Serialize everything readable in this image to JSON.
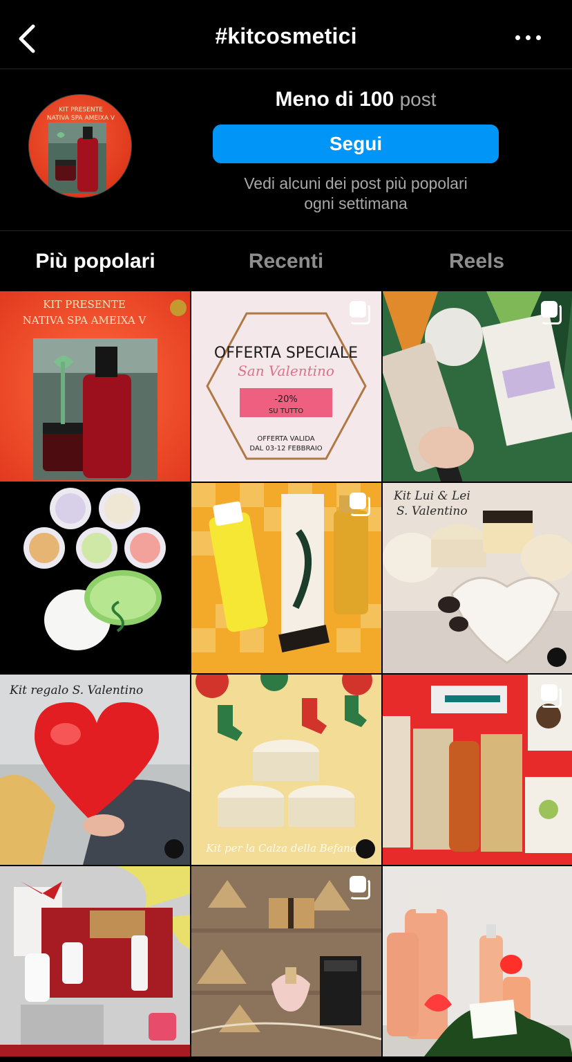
{
  "header": {
    "title": "#kitcosmetici",
    "back_icon": "chevron-left-icon",
    "more_icon": "more-horizontal-icon"
  },
  "hero": {
    "count_number": "Meno di 100",
    "count_unit": "post",
    "follow_label": "Segui",
    "hint_line1": "Vedi alcuni dei post più popolari",
    "hint_line2": "ogni settimana",
    "avatar_text_line1": "KIT PRESENTE",
    "avatar_text_line2": "NATIVA SPA AMEIXA V"
  },
  "tabs": [
    {
      "label": "Più popolari",
      "active": true
    },
    {
      "label": "Recenti",
      "active": false
    },
    {
      "label": "Reels",
      "active": false
    }
  ],
  "tiles": {
    "t1": {
      "line1": "KIT PRESENTE",
      "line2": "NATIVA SPA AMEIXA V"
    },
    "t2": {
      "title": "OFFERTA SPECIALE",
      "script": "San Valentino",
      "discount": "-20%",
      "discount_sub": "SU TUTTO",
      "valid1": "OFFERTA VALIDA",
      "valid2": "DAL 03-12 FEBBRAIO"
    },
    "t6": {
      "line1": "Kit Lui & Lei",
      "line2": "S. Valentino"
    },
    "t7": {
      "line1": "Kit regalo S. Valentino"
    },
    "t8": {
      "line1": "Kit per la Calza della Befana"
    }
  },
  "colors": {
    "accent": "#0095f6",
    "background": "#000000",
    "muted": "#a8a8a8"
  }
}
